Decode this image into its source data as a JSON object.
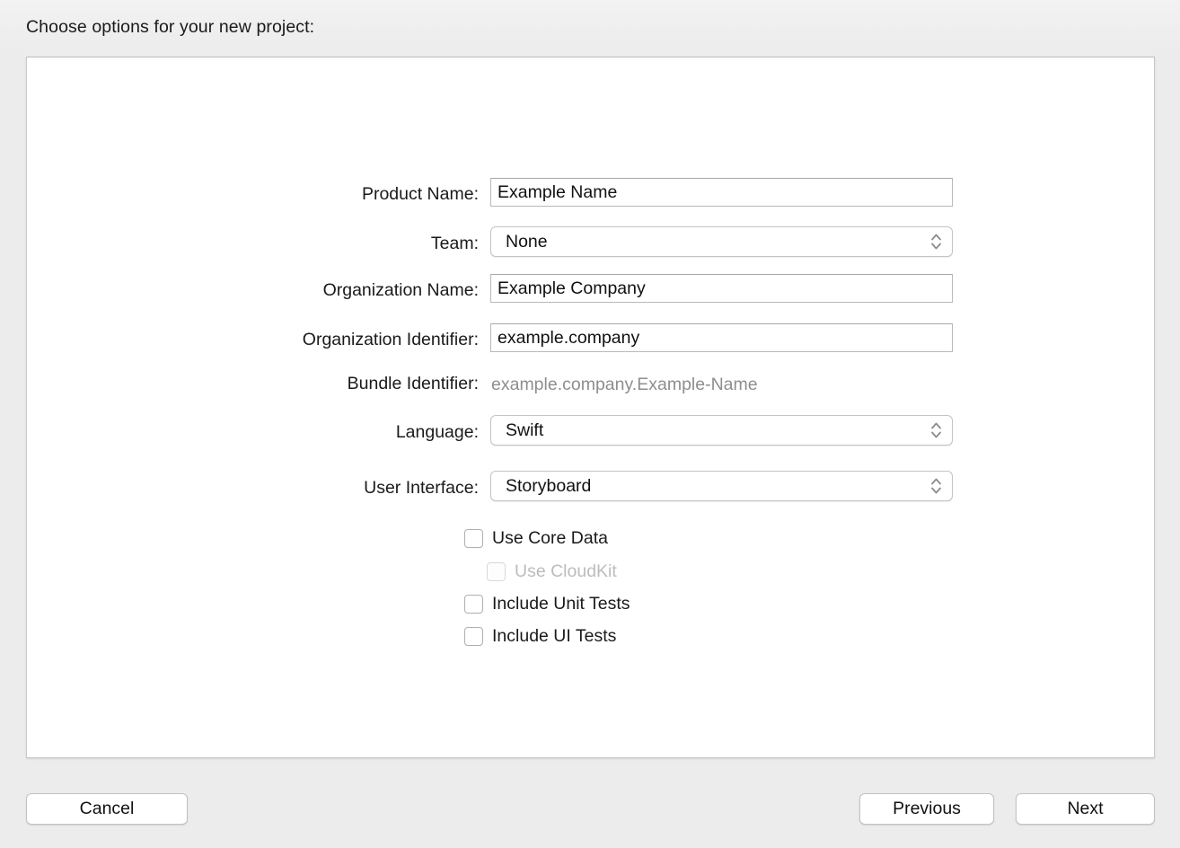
{
  "header": {
    "prompt": "Choose options for your new project:"
  },
  "form": {
    "fields": [
      {
        "label": "Product Name:",
        "type": "text",
        "value": "Example Name"
      },
      {
        "label": "Team:",
        "type": "popup",
        "value": "None"
      },
      {
        "label": "Organization Name:",
        "type": "text",
        "value": "Example Company"
      },
      {
        "label": "Organization Identifier:",
        "type": "text",
        "value": "example.company"
      },
      {
        "label": "Bundle Identifier:",
        "type": "static",
        "value": "example.company.Example-Name"
      },
      {
        "label": "Language:",
        "type": "popup",
        "value": "Swift"
      },
      {
        "label": "User Interface:",
        "type": "popup",
        "value": "Storyboard"
      }
    ],
    "checkboxes": [
      {
        "label": "Use Core Data",
        "checked": false,
        "disabled": false,
        "indented": false
      },
      {
        "label": "Use CloudKit",
        "checked": false,
        "disabled": true,
        "indented": true
      },
      {
        "label": "Include Unit Tests",
        "checked": false,
        "disabled": false,
        "indented": false
      },
      {
        "label": "Include UI Tests",
        "checked": false,
        "disabled": false,
        "indented": false
      }
    ]
  },
  "footer": {
    "cancel_label": "Cancel",
    "previous_label": "Previous",
    "next_label": "Next"
  },
  "icons": {
    "popup_chevrons": "chevron-up-down-icon"
  }
}
